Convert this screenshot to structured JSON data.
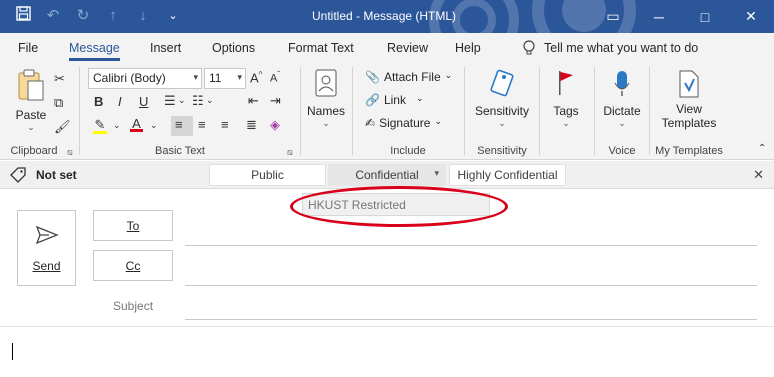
{
  "window": {
    "title": "Untitled  -  Message (HTML)",
    "qat_icons": [
      "save-icon",
      "undo-icon",
      "redo-icon",
      "up-arrow-icon",
      "down-arrow-icon",
      "customize-qat-icon"
    ],
    "controls": {
      "ribbon_options": "▭",
      "minimize": "─",
      "maximize": "□",
      "close": "✕"
    },
    "accent": "#2b579a"
  },
  "tabs": [
    {
      "label": "File"
    },
    {
      "label": "Message",
      "active": true
    },
    {
      "label": "Insert"
    },
    {
      "label": "Options"
    },
    {
      "label": "Format Text"
    },
    {
      "label": "Review"
    },
    {
      "label": "Help"
    }
  ],
  "tell_me": {
    "label": "Tell me what you want to do",
    "icon": "lightbulb-icon"
  },
  "ribbon": {
    "clipboard": {
      "paste": "Paste",
      "group": "Clipboard"
    },
    "basic_text": {
      "font": "Calibri (Body)",
      "size": "11",
      "group": "Basic Text"
    },
    "names": {
      "label": "Names"
    },
    "include": {
      "attach": "Attach File",
      "link": "Link",
      "signature": "Signature",
      "group": "Include"
    },
    "sensitivity": {
      "label": "Sensitivity",
      "group": "Sensitivity"
    },
    "tags": {
      "label": "Tags"
    },
    "voice": {
      "label": "Dictate",
      "group": "Voice"
    },
    "templates": {
      "label1": "View",
      "label2": "Templates",
      "group": "My Templates"
    }
  },
  "sensitivity_bar": {
    "status": "Not set",
    "labels": [
      "Public",
      "Confidential",
      "Highly Confidential"
    ],
    "selected": "Confidential",
    "dropdown_item": "HKUST Restricted",
    "annotation_color": "#d9001b"
  },
  "compose": {
    "send": "Send",
    "to": "To",
    "cc": "Cc",
    "subject": "Subject"
  }
}
